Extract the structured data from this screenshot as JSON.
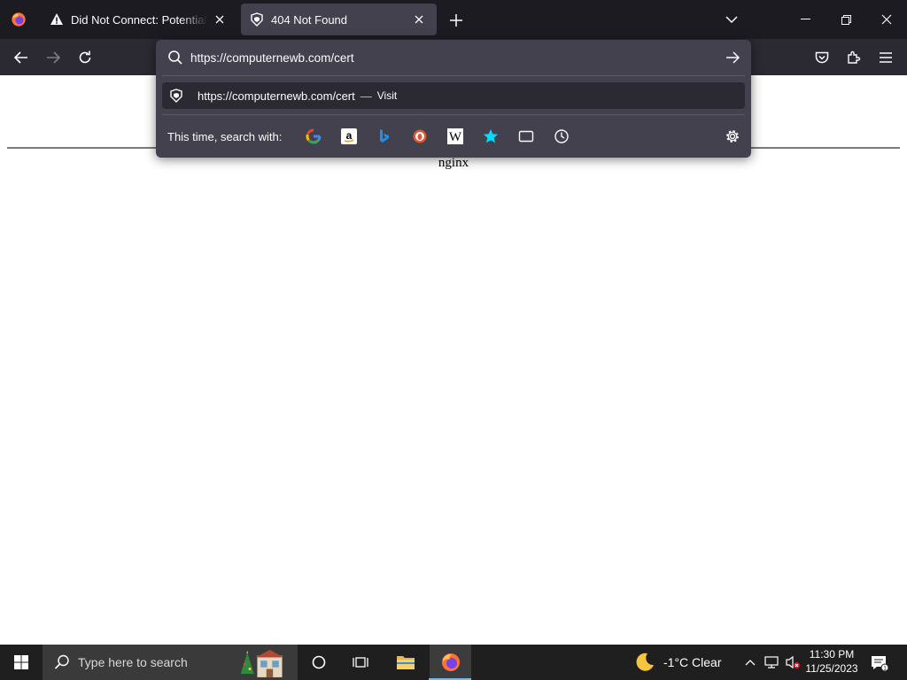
{
  "browser": {
    "tabs": [
      {
        "title": "Did Not Connect: Potential Security Issue",
        "icon": "warning-icon",
        "active": false
      },
      {
        "title": "404 Not Found",
        "icon": "generic-page-icon",
        "active": true
      }
    ],
    "url": "https://computernewb.com/cert"
  },
  "urlbar": {
    "result": {
      "url": "https://computernewb.com/cert",
      "dash": "—",
      "action": "Visit"
    },
    "oneoff_label": "This time, search with:",
    "engines": [
      "google-icon",
      "amazon-icon",
      "bing-icon",
      "duckduckgo-icon",
      "wikipedia-icon",
      "bookmarks-icon",
      "tabs-icon",
      "history-icon"
    ]
  },
  "page": {
    "server": "nginx"
  },
  "taskbar": {
    "search_placeholder": "Type here to search",
    "weather": "-1°C  Clear",
    "time": "11:30 PM",
    "date": "11/25/2023"
  },
  "colors": {
    "tabstrip": "#1c1b22",
    "toolbar": "#2b2a33",
    "urlbar": "#42414d",
    "taskbar": "#1f1f1f",
    "accent": "#76b9ed"
  }
}
